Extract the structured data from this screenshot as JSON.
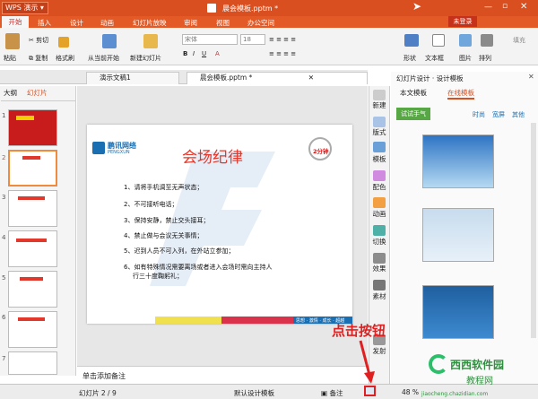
{
  "titlebar": {
    "app_name": "WPS 演示",
    "doc_title": "晨会模板.pptm *"
  },
  "menu": {
    "items": [
      "开始",
      "插入",
      "设计",
      "动画",
      "幻灯片放映",
      "审阅",
      "视图",
      "办公空间"
    ],
    "login_label": "未登录"
  },
  "toolbar": {
    "paste_label": "粘贴",
    "cut_label": "剪切",
    "copy_label": "复制",
    "format_painter_label": "格式刷",
    "from_current_label": "从当前开始",
    "new_slide_label": "新建幻灯片",
    "font_name": "宋体",
    "font_size": "18",
    "shape_label": "形状",
    "textbox_label": "文本框",
    "picture_label": "图片",
    "arrange_label": "排列",
    "fill_label": "填充"
  },
  "tabs": [
    {
      "label": "演示文稿1"
    },
    {
      "label": "晨会模板.pptm *"
    }
  ],
  "left_panel": {
    "tab_outline": "大纲",
    "tab_slides": "幻灯片",
    "slide_numbers": [
      "1",
      "2",
      "3",
      "4",
      "5",
      "6",
      "7"
    ]
  },
  "slide": {
    "logo_text": "鹏讯网络",
    "logo_sub": "PENGXUN",
    "title": "会场纪律",
    "clock_label": "2分钟",
    "bullets": [
      "1、请将手机调至无声状态；",
      "2、不可接听电话；",
      "3、保持安静，禁止交头接耳；",
      "4、禁止做与会议无关事情；",
      "5、迟到人员不可入列，在外站立参加；",
      "6、如有特殊情况需要离场或者进入会场时需向主持人",
      "行三十度鞠躬礼；"
    ],
    "footer_text": "思想 · 激情 · 成长 · 超越"
  },
  "notes": {
    "placeholder": "单击添加备注"
  },
  "right_strip": [
    "新建",
    "版式",
    "模板",
    "配色",
    "动画",
    "切换",
    "效果",
    "素材",
    "发射"
  ],
  "design_panel": {
    "title": "幻灯片设计 · 设计模板",
    "tab_local": "本文模板",
    "tab_online": "在线模板",
    "category": "试试手气",
    "filters": [
      "时尚",
      "宽屏",
      "其他"
    ]
  },
  "status": {
    "slide_count": "幻灯片 2 / 9",
    "template_name": "默认设计模板",
    "notes_label": "备注",
    "zoom": "48 %"
  },
  "annotation": {
    "callout": "点击按钮"
  },
  "watermark": {
    "line1": "西西软件园",
    "line2": "教程网",
    "url": "jiaocheng.chazidian.com"
  },
  "colors": {
    "accent": "#e45a26",
    "title_red": "#e2382b",
    "brand_blue": "#1a6fb3"
  }
}
